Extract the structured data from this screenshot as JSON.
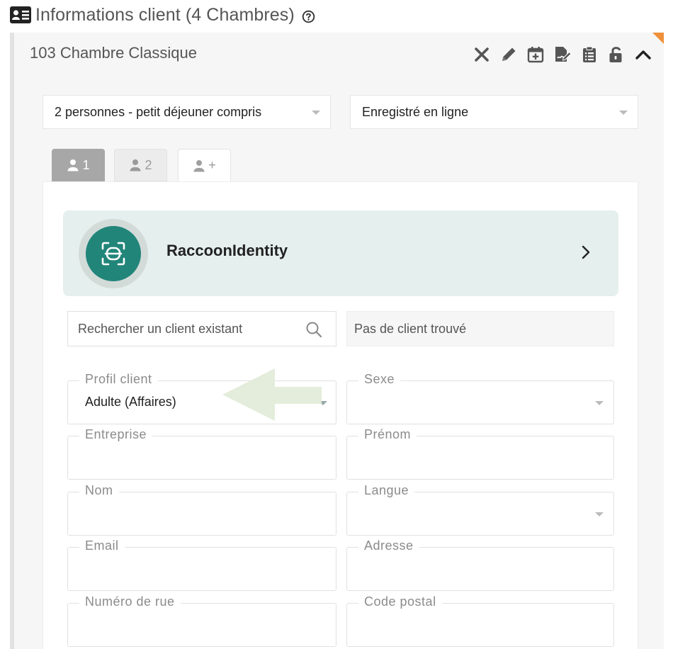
{
  "header": {
    "title": "Informations client (4 Chambres)",
    "icons": [
      "id-card-icon",
      "help-circle-icon"
    ]
  },
  "room": {
    "title": "103 Chambre Classique",
    "toolbar_icons": [
      "close-icon",
      "pencil-icon",
      "calendar-plus-icon",
      "signature-icon",
      "clipboard-list-icon",
      "unlock-icon",
      "chevron-up-icon"
    ]
  },
  "selects": {
    "rate_value": "2 personnes - petit déjeuner compris",
    "status_value": "Enregistré en ligne"
  },
  "tabs": [
    {
      "label": "1",
      "active": true
    },
    {
      "label": "2",
      "active": false
    },
    {
      "label": "+",
      "active": false
    }
  ],
  "banner": {
    "label": "RaccoonIdentity"
  },
  "search": {
    "placeholder": "Rechercher un client existant",
    "no_result": "Pas de client trouvé"
  },
  "fields": {
    "profil_label": "Profil client",
    "profil_value": "Adulte (Affaires)",
    "sexe_label": "Sexe",
    "entreprise_label": "Entreprise",
    "prenom_label": "Prénom",
    "nom_label": "Nom",
    "langue_label": "Langue",
    "email_label": "Email",
    "adresse_label": "Adresse",
    "numero_label": "Numéro de rue",
    "code_postal_label": "Code postal"
  },
  "colors": {
    "accent": "#22857a",
    "banner_bg": "#e5efed",
    "corner": "#f0903a",
    "active_tab": "#a7a7a7",
    "annotation_arrow": "#e2ecd8"
  }
}
